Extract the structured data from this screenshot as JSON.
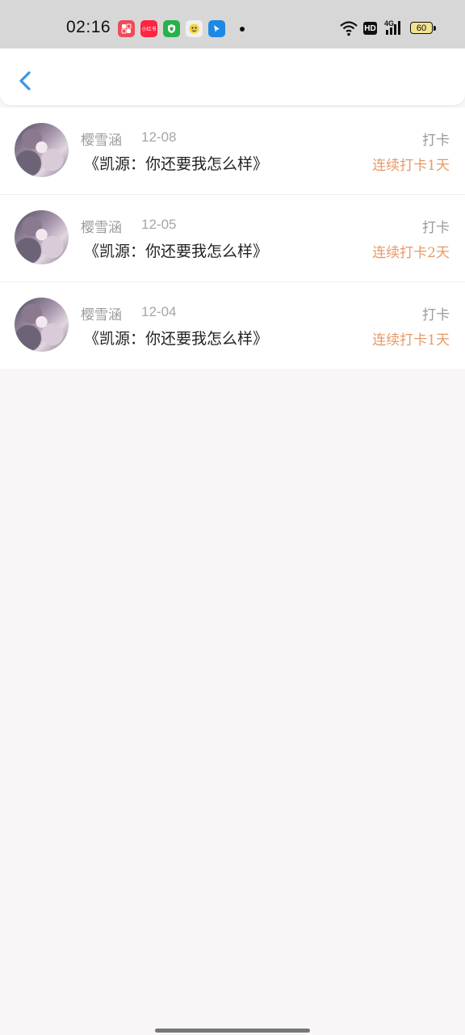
{
  "status_bar": {
    "time": "02:16",
    "battery": "60",
    "network_label": "4G",
    "hd_label": "HD",
    "app_icons": [
      {
        "name": "gallery-app-icon",
        "color": "#f04a5a"
      },
      {
        "name": "xiaohongshu-app-icon",
        "color": "#ff2442",
        "label": "小红书"
      },
      {
        "name": "shield-app-icon",
        "color": "#27b24a"
      },
      {
        "name": "face-app-icon",
        "color": "#f0f0f0"
      },
      {
        "name": "blue-app-icon",
        "color": "#1e88e5"
      }
    ]
  },
  "colors": {
    "back_arrow": "#3a97e6",
    "streak": "#e79a66",
    "muted": "#9a9a9a",
    "title": "#222222",
    "background": "#f8f6f7"
  },
  "list": [
    {
      "name": "樱雪涵",
      "date": "12-08",
      "title": "《凯源：你还要我怎么样》",
      "action": "打卡",
      "streak": "连续打卡1天"
    },
    {
      "name": "樱雪涵",
      "date": "12-05",
      "title": "《凯源：你还要我怎么样》",
      "action": "打卡",
      "streak": "连续打卡2天"
    },
    {
      "name": "樱雪涵",
      "date": "12-04",
      "title": "《凯源：你还要我怎么样》",
      "action": "打卡",
      "streak": "连续打卡1天"
    }
  ]
}
